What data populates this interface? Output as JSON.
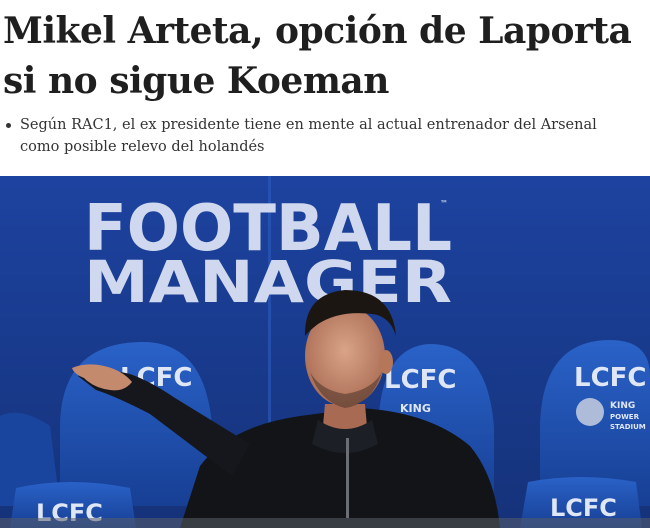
{
  "article": {
    "headline": "Mikel Arteta, opción de Laporta si no sigue Koeman",
    "summary": "Según RAC1, el ex presidente tiene en mente al actual entrenador del Arsenal como posible relevo del holandés"
  },
  "photo": {
    "board_line1": "FOOTBALL",
    "board_line2": "MANAGER",
    "board_tm": "™",
    "seat_label": "LCFC",
    "seat_sub1": "KING",
    "seat_sub2": "POWER",
    "seat_sub3": "STADIUM"
  },
  "colors": {
    "photo_background": "#1b3f8f",
    "seat_blue": "#1e4fb0",
    "jacket": "#121418"
  }
}
